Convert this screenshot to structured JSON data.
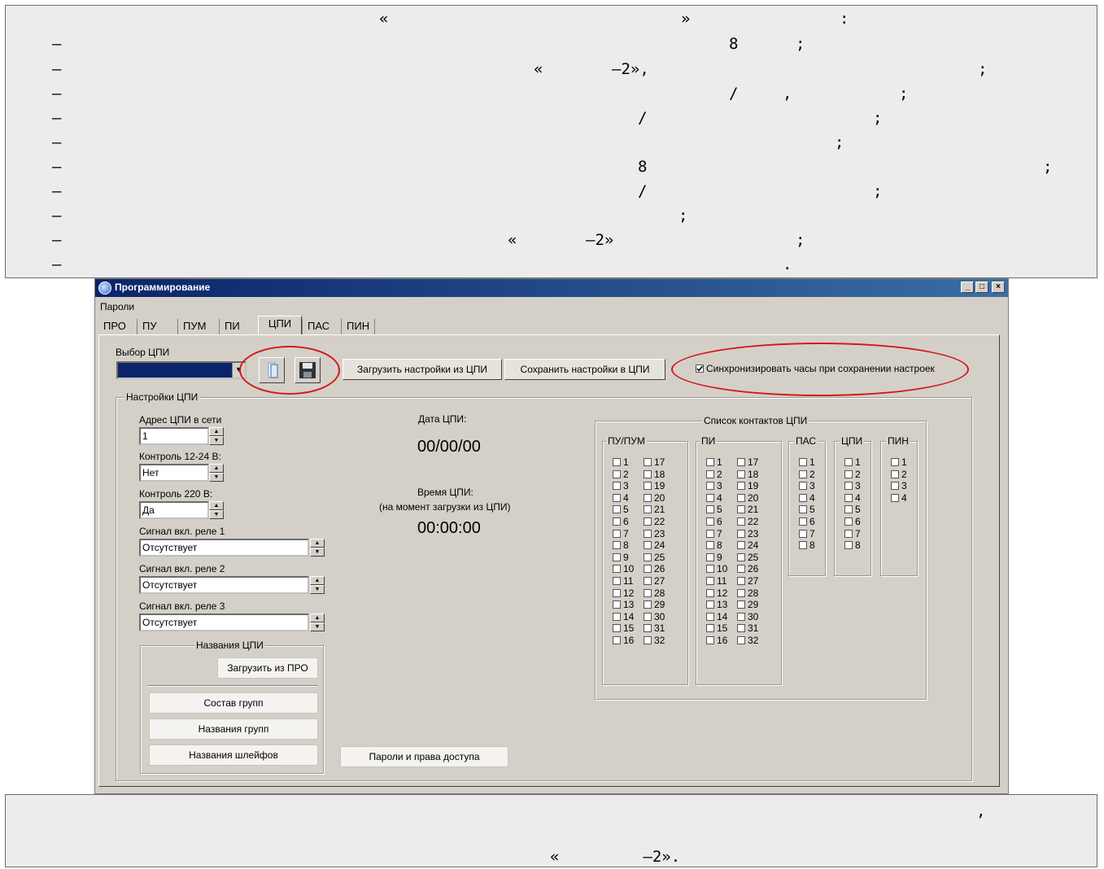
{
  "doc_top": {
    "row0": [
      "«",
      "»",
      ":"
    ],
    "row1": [
      "–",
      "8",
      ";"
    ],
    "row2": [
      "–",
      "«",
      "–2»,",
      ";"
    ],
    "row3": [
      "–",
      "/",
      ",",
      ";"
    ],
    "row4": [
      "–",
      "/",
      ";"
    ],
    "row5": [
      "–",
      ";"
    ],
    "row6": [
      "–",
      "8",
      ";"
    ],
    "row7": [
      "–",
      "/",
      ";"
    ],
    "row8": [
      "–",
      ";"
    ],
    "row9": [
      "–",
      "«",
      "–2»",
      ";"
    ],
    "row10": [
      "–",
      "."
    ]
  },
  "doc_bottom": {
    "comma": ",",
    "tail": "«         –2»."
  },
  "window": {
    "title": "Программирование",
    "minimize": "_",
    "maximize": "□",
    "close": "×",
    "menu": "Пароли",
    "tabs": [
      "ПРО",
      "ПУ",
      "ПУМ",
      "ПИ",
      "ЦПИ",
      "ПАС",
      "ПИН"
    ],
    "active_tab": "ЦПИ",
    "select_label": "Выбор ЦПИ",
    "load_btn": "Загрузить настройки из ЦПИ",
    "save_btn": "Сохранить настройки в ЦПИ",
    "sync_checkbox": "Синхронизировать часы при сохранении настроек",
    "sync_checked": true,
    "settings_group": "Настройки ЦПИ",
    "address_label": "Адрес ЦПИ в сети",
    "address_value": "1",
    "ctrl1224_label": "Контроль 12-24 В:",
    "ctrl1224_value": "Нет",
    "ctrl220_label": "Контроль 220 В:",
    "ctrl220_value": "Да",
    "relay1_label": "Сигнал вкл. реле 1",
    "relay1_value": "Отсутствует",
    "relay2_label": "Сигнал вкл. реле 2",
    "relay2_value": "Отсутствует",
    "relay3_label": "Сигнал вкл. реле 3",
    "relay3_value": "Отсутствует",
    "names_group": "Названия ЦПИ",
    "load_from_pro": "Загрузить из ПРО",
    "group_comp": "Состав групп",
    "group_names": "Названия групп",
    "loop_names": "Названия шлейфов",
    "passwords_btn": "Пароли и права доступа",
    "date_label": "Дата ЦПИ:",
    "date_value": "00/00/00",
    "time_label": "Время ЦПИ:",
    "time_note": "(на момент загрузки из ЦПИ)",
    "time_value": "00:00:00",
    "contacts_group": "Список контактов ЦПИ",
    "col_pu": "ПУ/ПУМ",
    "col_pi": "ПИ",
    "col_pas": "ПАС",
    "col_cpi": "ЦПИ",
    "col_pin": "ПИН"
  }
}
